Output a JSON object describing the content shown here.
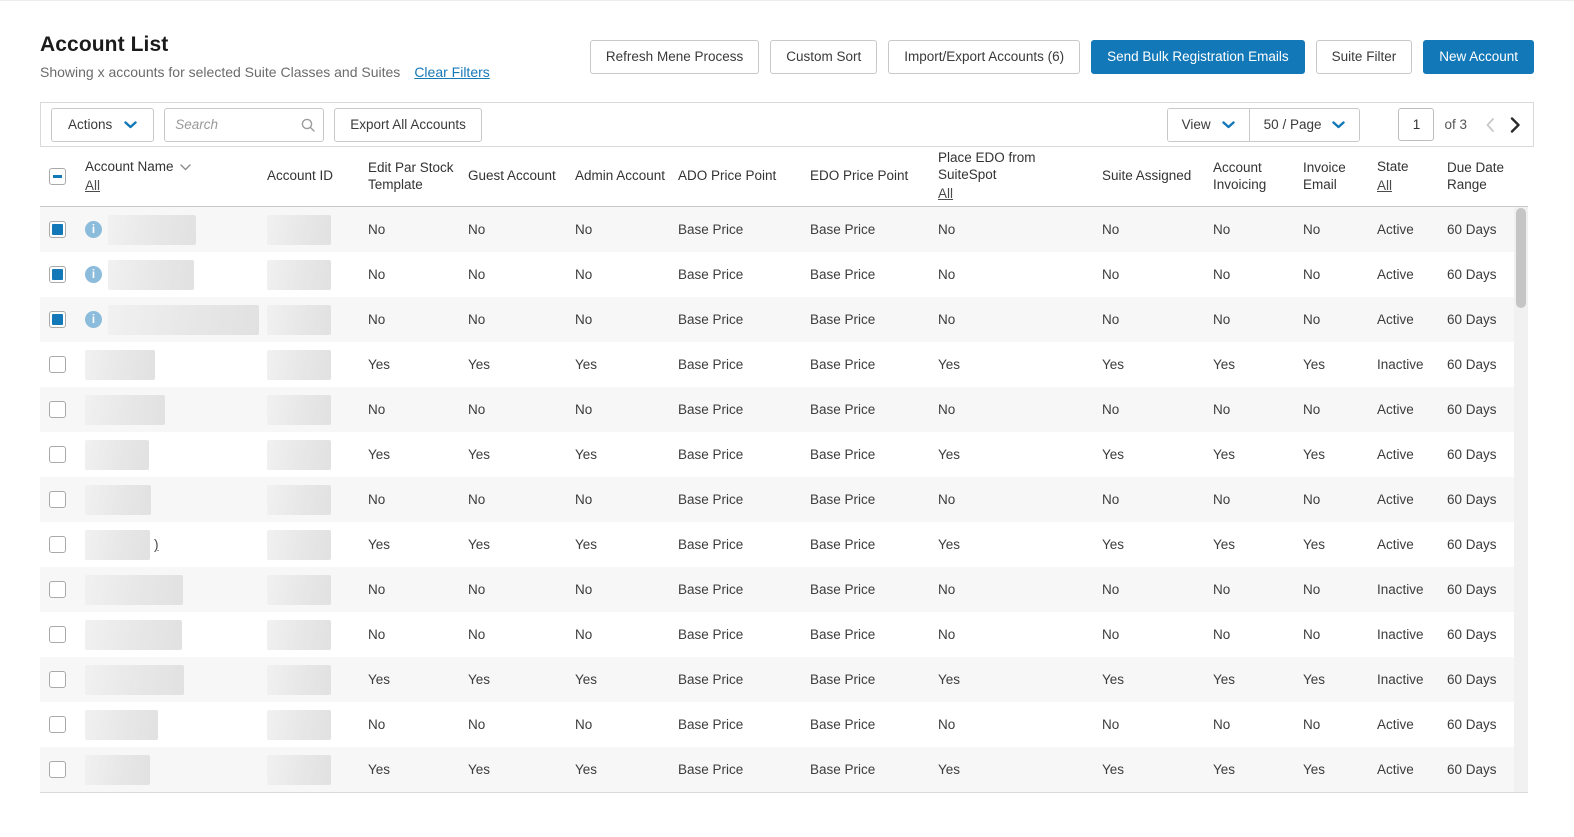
{
  "page": {
    "title": "Account List",
    "subtitle": "Showing x accounts for selected Suite Classes and Suites",
    "clear_filters_label": "Clear Filters"
  },
  "header_buttons": [
    {
      "name": "refresh-mene-process-button",
      "label": "Refresh Mene Process",
      "variant": "secondary"
    },
    {
      "name": "custom-sort-button",
      "label": "Custom Sort",
      "variant": "secondary"
    },
    {
      "name": "import-export-accounts-button",
      "label": "Import/Export Accounts (6)",
      "variant": "secondary"
    },
    {
      "name": "send-bulk-registration-emails-button",
      "label": "Send Bulk Registration Emails",
      "variant": "primary"
    },
    {
      "name": "suite-filter-button",
      "label": "Suite Filter",
      "variant": "secondary"
    },
    {
      "name": "new-account-button",
      "label": "New Account",
      "variant": "primary"
    }
  ],
  "toolbar": {
    "actions_label": "Actions",
    "search_placeholder": "Search",
    "export_all_label": "Export All Accounts",
    "view_label": "View",
    "per_page_label": "50 / Page",
    "page_value": "1",
    "page_total_label": "of 3"
  },
  "table": {
    "columns": [
      {
        "key": "name",
        "label": "Account Name",
        "sortable": true,
        "filter_all_label": "All"
      },
      {
        "key": "account_id",
        "label": "Account ID"
      },
      {
        "key": "edit_par_stock",
        "label": "Edit Par Stock Template"
      },
      {
        "key": "guest_account",
        "label": "Guest Account"
      },
      {
        "key": "admin_account",
        "label": "Admin Account"
      },
      {
        "key": "ado_price_point",
        "label": "ADO Price Point"
      },
      {
        "key": "edo_price_point",
        "label": "EDO Price Point"
      },
      {
        "key": "place_edo",
        "label": "Place EDO from SuiteSpot",
        "filter_all_label": "All"
      },
      {
        "key": "suite_assigned",
        "label": "Suite Assigned"
      },
      {
        "key": "account_invoicing",
        "label": "Account Invoicing"
      },
      {
        "key": "invoice_email",
        "label": "Invoice Email"
      },
      {
        "key": "state",
        "label": "State",
        "filter_all_label": "All"
      },
      {
        "key": "due_date_range",
        "label": "Due Date Range"
      }
    ],
    "rows": [
      {
        "selected": true,
        "has_info": true,
        "name_redacted_width": 88,
        "name_visible_suffix": "",
        "id_redacted_width": 64,
        "edit_par_stock": "No",
        "guest_account": "No",
        "admin_account": "No",
        "ado_price_point": "Base Price",
        "edo_price_point": "Base Price",
        "place_edo": "No",
        "suite_assigned": "No",
        "account_invoicing": "No",
        "invoice_email": "No",
        "state": "Active",
        "due_date_range": "60 Days"
      },
      {
        "selected": true,
        "has_info": true,
        "name_redacted_width": 86,
        "name_visible_suffix": "",
        "id_redacted_width": 64,
        "edit_par_stock": "No",
        "guest_account": "No",
        "admin_account": "No",
        "ado_price_point": "Base Price",
        "edo_price_point": "Base Price",
        "place_edo": "No",
        "suite_assigned": "No",
        "account_invoicing": "No",
        "invoice_email": "No",
        "state": "Active",
        "due_date_range": "60 Days"
      },
      {
        "selected": true,
        "has_info": true,
        "name_redacted_width": 151,
        "name_visible_suffix": "",
        "id_redacted_width": 64,
        "edit_par_stock": "No",
        "guest_account": "No",
        "admin_account": "No",
        "ado_price_point": "Base Price",
        "edo_price_point": "Base Price",
        "place_edo": "No",
        "suite_assigned": "No",
        "account_invoicing": "No",
        "invoice_email": "No",
        "state": "Active",
        "due_date_range": "60 Days"
      },
      {
        "selected": false,
        "has_info": false,
        "name_redacted_width": 70,
        "name_visible_suffix": "",
        "id_redacted_width": 64,
        "edit_par_stock": "Yes",
        "guest_account": "Yes",
        "admin_account": "Yes",
        "ado_price_point": "Base Price",
        "edo_price_point": "Base Price",
        "place_edo": "Yes",
        "suite_assigned": "Yes",
        "account_invoicing": "Yes",
        "invoice_email": "Yes",
        "state": "Inactive",
        "due_date_range": "60 Days"
      },
      {
        "selected": false,
        "has_info": false,
        "name_redacted_width": 80,
        "name_visible_suffix": "",
        "id_redacted_width": 64,
        "edit_par_stock": "No",
        "guest_account": "No",
        "admin_account": "No",
        "ado_price_point": "Base Price",
        "edo_price_point": "Base Price",
        "place_edo": "No",
        "suite_assigned": "No",
        "account_invoicing": "No",
        "invoice_email": "No",
        "state": "Active",
        "due_date_range": "60 Days"
      },
      {
        "selected": false,
        "has_info": false,
        "name_redacted_width": 64,
        "name_visible_suffix": "",
        "id_redacted_width": 64,
        "edit_par_stock": "Yes",
        "guest_account": "Yes",
        "admin_account": "Yes",
        "ado_price_point": "Base Price",
        "edo_price_point": "Base Price",
        "place_edo": "Yes",
        "suite_assigned": "Yes",
        "account_invoicing": "Yes",
        "invoice_email": "Yes",
        "state": "Active",
        "due_date_range": "60 Days"
      },
      {
        "selected": false,
        "has_info": false,
        "name_redacted_width": 66,
        "name_visible_suffix": "",
        "id_redacted_width": 64,
        "edit_par_stock": "No",
        "guest_account": "No",
        "admin_account": "No",
        "ado_price_point": "Base Price",
        "edo_price_point": "Base Price",
        "place_edo": "No",
        "suite_assigned": "No",
        "account_invoicing": "No",
        "invoice_email": "No",
        "state": "Active",
        "due_date_range": "60 Days"
      },
      {
        "selected": false,
        "has_info": false,
        "name_redacted_width": 65,
        "name_visible_suffix": ")",
        "id_redacted_width": 64,
        "edit_par_stock": "Yes",
        "guest_account": "Yes",
        "admin_account": "Yes",
        "ado_price_point": "Base Price",
        "edo_price_point": "Base Price",
        "place_edo": "Yes",
        "suite_assigned": "Yes",
        "account_invoicing": "Yes",
        "invoice_email": "Yes",
        "state": "Active",
        "due_date_range": "60 Days"
      },
      {
        "selected": false,
        "has_info": false,
        "name_redacted_width": 98,
        "name_visible_suffix": "",
        "id_redacted_width": 64,
        "edit_par_stock": "No",
        "guest_account": "No",
        "admin_account": "No",
        "ado_price_point": "Base Price",
        "edo_price_point": "Base Price",
        "place_edo": "No",
        "suite_assigned": "No",
        "account_invoicing": "No",
        "invoice_email": "No",
        "state": "Inactive",
        "due_date_range": "60 Days"
      },
      {
        "selected": false,
        "has_info": false,
        "name_redacted_width": 97,
        "name_visible_suffix": "",
        "id_redacted_width": 64,
        "edit_par_stock": "No",
        "guest_account": "No",
        "admin_account": "No",
        "ado_price_point": "Base Price",
        "edo_price_point": "Base Price",
        "place_edo": "No",
        "suite_assigned": "No",
        "account_invoicing": "No",
        "invoice_email": "No",
        "state": "Inactive",
        "due_date_range": "60 Days"
      },
      {
        "selected": false,
        "has_info": false,
        "name_redacted_width": 99,
        "name_visible_suffix": "",
        "id_redacted_width": 64,
        "edit_par_stock": "Yes",
        "guest_account": "Yes",
        "admin_account": "Yes",
        "ado_price_point": "Base Price",
        "edo_price_point": "Base Price",
        "place_edo": "Yes",
        "suite_assigned": "Yes",
        "account_invoicing": "Yes",
        "invoice_email": "Yes",
        "state": "Inactive",
        "due_date_range": "60 Days"
      },
      {
        "selected": false,
        "has_info": false,
        "name_redacted_width": 73,
        "name_visible_suffix": "",
        "id_redacted_width": 64,
        "edit_par_stock": "No",
        "guest_account": "No",
        "admin_account": "No",
        "ado_price_point": "Base Price",
        "edo_price_point": "Base Price",
        "place_edo": "No",
        "suite_assigned": "No",
        "account_invoicing": "No",
        "invoice_email": "No",
        "state": "Active",
        "due_date_range": "60 Days"
      },
      {
        "selected": false,
        "has_info": false,
        "name_redacted_width": 65,
        "name_visible_suffix": "",
        "id_redacted_width": 64,
        "edit_par_stock": "Yes",
        "guest_account": "Yes",
        "admin_account": "Yes",
        "ado_price_point": "Base Price",
        "edo_price_point": "Base Price",
        "place_edo": "Yes",
        "suite_assigned": "Yes",
        "account_invoicing": "Yes",
        "invoice_email": "Yes",
        "state": "Active",
        "due_date_range": "60 Days"
      }
    ]
  },
  "colors": {
    "primary_blue": "#1278b8",
    "link_blue": "#1779b8",
    "info_icon_blue": "#8cbcdc",
    "row_stripe": "#f7f7f7"
  }
}
